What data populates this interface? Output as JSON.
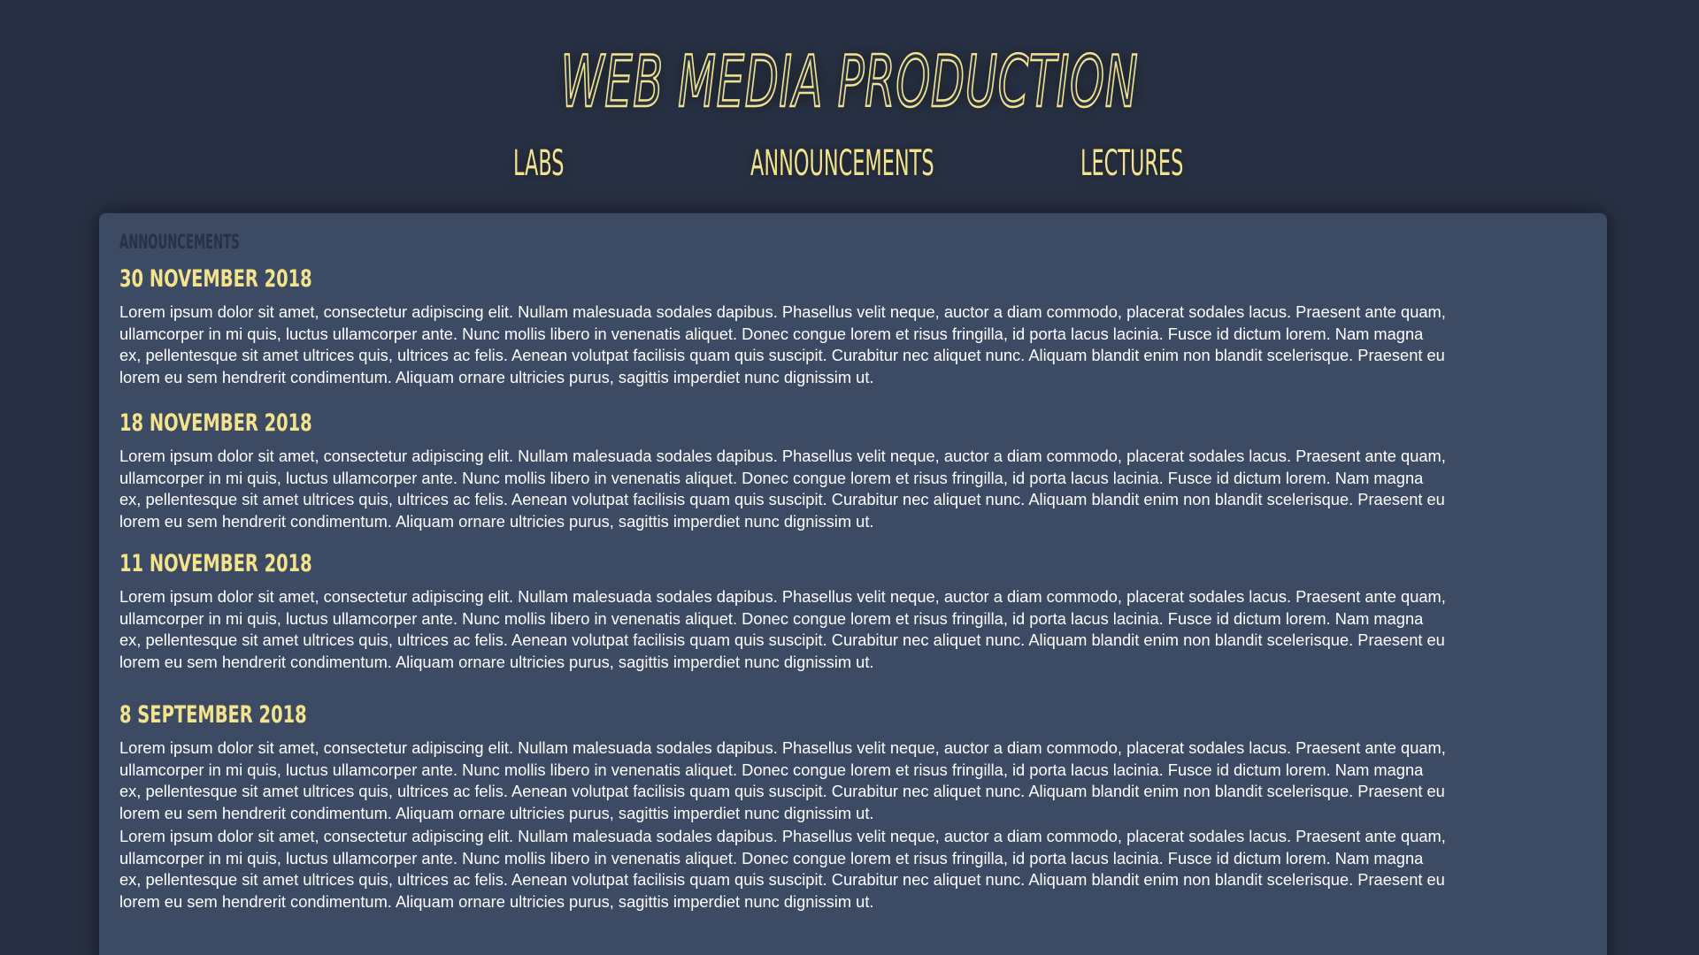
{
  "header": {
    "title": "WEB MEDIA PRODUCTION"
  },
  "nav": {
    "items": [
      {
        "label": "LABS"
      },
      {
        "label": "ANNOUNCEMENTS"
      },
      {
        "label": "LECTURES"
      }
    ]
  },
  "main": {
    "section_label": "ANNOUNCEMENTS",
    "entries": [
      {
        "date": "30 NOVEMBER 2018",
        "paragraphs": [
          "Lorem ipsum dolor sit amet, consectetur adipiscing elit. Nullam malesuada sodales dapibus. Phasellus velit neque, auctor a diam commodo, placerat sodales lacus. Praesent ante quam,\nullamcorper in mi quis, luctus ullamcorper ante. Nunc mollis libero in venenatis aliquet. Donec congue lorem et risus fringilla, id porta lacus lacinia. Fusce id dictum lorem. Nam magna\nex, pellentesque sit amet ultrices quis, ultrices ac felis. Aenean volutpat facilisis quam quis suscipit. Curabitur nec aliquet nunc. Aliquam blandit enim non blandit scelerisque. Praesent eu\n lorem eu sem hendrerit condimentum. Aliquam ornare ultricies purus, sagittis imperdiet nunc dignissim ut."
        ]
      },
      {
        "date": "18 NOVEMBER 2018",
        "paragraphs": [
          "Lorem ipsum dolor sit amet, consectetur adipiscing elit. Nullam malesuada sodales dapibus. Phasellus velit neque, auctor a diam commodo, placerat sodales lacus. Praesent ante quam,\nullamcorper in mi quis, luctus ullamcorper ante. Nunc mollis libero in venenatis aliquet. Donec congue lorem et risus fringilla, id porta lacus lacinia. Fusce id dictum lorem. Nam magna\nex, pellentesque sit amet ultrices quis, ultrices ac felis. Aenean volutpat facilisis quam quis suscipit. Curabitur nec aliquet nunc. Aliquam blandit enim non blandit scelerisque. Praesent eu\n lorem eu sem hendrerit condimentum. Aliquam ornare ultricies purus, sagittis imperdiet nunc dignissim ut."
        ]
      },
      {
        "date": "11 NOVEMBER 2018",
        "paragraphs": [
          "Lorem ipsum dolor sit amet, consectetur adipiscing elit. Nullam malesuada sodales dapibus. Phasellus velit neque, auctor a diam commodo, placerat sodales lacus. Praesent ante quam,\nullamcorper in mi quis, luctus ullamcorper ante. Nunc mollis libero in venenatis aliquet. Donec congue lorem et risus fringilla, id porta lacus lacinia. Fusce id dictum lorem. Nam magna\nex, pellentesque sit amet ultrices quis, ultrices ac felis. Aenean volutpat facilisis quam quis suscipit. Curabitur nec aliquet nunc. Aliquam blandit enim non blandit scelerisque. Praesent eu\n lorem eu sem hendrerit condimentum. Aliquam ornare ultricies purus, sagittis imperdiet nunc dignissim ut."
        ]
      },
      {
        "date": "8 SEPTEMBER 2018",
        "paragraphs": [
          "Lorem ipsum dolor sit amet, consectetur adipiscing elit. Nullam malesuada sodales dapibus. Phasellus velit neque, auctor a diam commodo, placerat sodales lacus. Praesent ante quam,\nullamcorper in mi quis, luctus ullamcorper ante. Nunc mollis libero in venenatis aliquet. Donec congue lorem et risus fringilla, id porta lacus lacinia. Fusce id dictum lorem. Nam magna\nex, pellentesque sit amet ultrices quis, ultrices ac felis. Aenean volutpat facilisis quam quis suscipit. Curabitur nec aliquet nunc. Aliquam blandit enim non blandit scelerisque. Praesent eu\n lorem eu sem hendrerit condimentum. Aliquam ornare ultricies purus, sagittis imperdiet nunc dignissim ut.",
          "Lorem ipsum dolor sit amet, consectetur adipiscing elit. Nullam malesuada sodales dapibus. Phasellus velit neque, auctor a diam commodo, placerat sodales lacus. Praesent ante quam,\nullamcorper in mi quis, luctus ullamcorper ante. Nunc mollis libero in venenatis aliquet. Donec congue lorem et risus fringilla, id porta lacus lacinia. Fusce id dictum lorem. Nam magna\nex, pellentesque sit amet ultrices quis, ultrices ac felis. Aenean volutpat facilisis quam quis suscipit. Curabitur nec aliquet nunc. Aliquam blandit enim non blandit scelerisque. Praesent eu\n lorem eu sem hendrerit condimentum. Aliquam ornare ultricies purus, sagittis imperdiet nunc dignissim ut."
        ]
      }
    ]
  },
  "colors": {
    "background": "#283144",
    "panel": "#3d4a64",
    "accent": "#f2e38c",
    "body_text": "#ffffff",
    "section_label": "#283144"
  }
}
